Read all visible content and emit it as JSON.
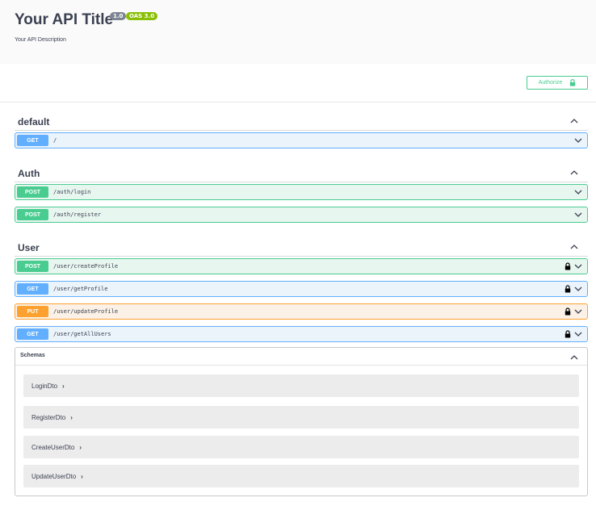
{
  "info": {
    "title": "Your API Title",
    "version_badge": "1.0",
    "oas_badge": "OAS 3.0",
    "description": "Your API Description"
  },
  "authorize": {
    "label": "Authorize",
    "icon": "lock-icon"
  },
  "tags": [
    {
      "name": "default",
      "operations": [
        {
          "method": "GET",
          "path": "/",
          "locked": false
        }
      ]
    },
    {
      "name": "Auth",
      "operations": [
        {
          "method": "POST",
          "path": "/auth/login",
          "locked": false
        },
        {
          "method": "POST",
          "path": "/auth/register",
          "locked": false
        }
      ]
    },
    {
      "name": "User",
      "operations": [
        {
          "method": "POST",
          "path": "/user/createProfile",
          "locked": true
        },
        {
          "method": "GET",
          "path": "/user/getProfile",
          "locked": true
        },
        {
          "method": "PUT",
          "path": "/user/updateProfile",
          "locked": true
        },
        {
          "method": "GET",
          "path": "/user/getAllUsers",
          "locked": true
        }
      ]
    }
  ],
  "schemas": {
    "title": "Schemas",
    "models": [
      {
        "name": "LoginDto",
        "arrow": "›"
      },
      {
        "name": "RegisterDto",
        "arrow": "›"
      },
      {
        "name": "CreateUserDto",
        "arrow": "›"
      },
      {
        "name": "UpdateUserDto",
        "arrow": "›"
      }
    ]
  },
  "colors": {
    "get": "#61affe",
    "post": "#49cc90",
    "put": "#fca130",
    "text": "#3b4151"
  }
}
